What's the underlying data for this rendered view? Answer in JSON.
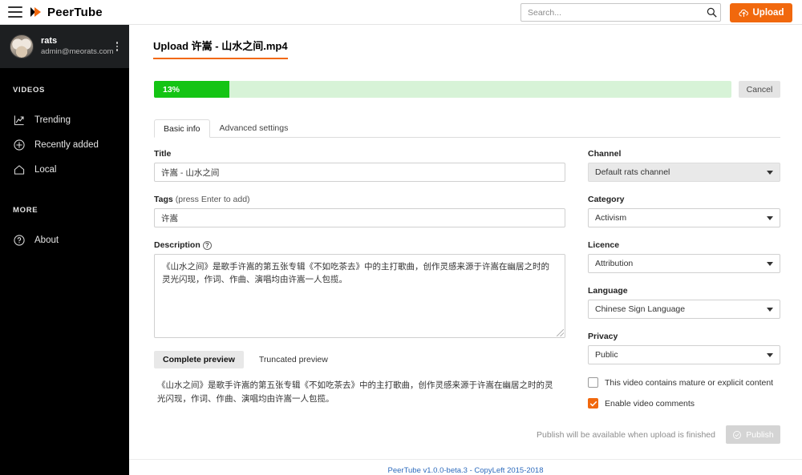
{
  "topbar": {
    "menu_icon": "hamburger-icon",
    "logo_text": "PeerTube",
    "search_placeholder": "Search...",
    "search_value": "",
    "search_icon": "search-icon",
    "upload_label": "Upload",
    "upload_icon": "cloud-upload-icon",
    "accent_color": "#f1680d"
  },
  "sidebar": {
    "user": {
      "name": "rats",
      "email": "admin@meorats.com",
      "avatar": "user-avatar",
      "menu_icon": "more-vertical-icon"
    },
    "sections": [
      {
        "heading": "VIDEOS",
        "items": [
          {
            "label": "Trending",
            "icon": "trending-chart-icon"
          },
          {
            "label": "Recently added",
            "icon": "plus-circle-icon"
          },
          {
            "label": "Local",
            "icon": "home-icon"
          }
        ]
      },
      {
        "heading": "MORE",
        "items": [
          {
            "label": "About",
            "icon": "question-circle-icon"
          }
        ]
      }
    ]
  },
  "main": {
    "page_title": "Upload 许嵩 - 山水之间.mp4",
    "progress": {
      "percent_label": "13%",
      "percent_value": 13,
      "fill_color": "#14c414",
      "track_color": "#d7f3d7",
      "cancel_label": "Cancel"
    },
    "tabs": [
      {
        "label": "Basic info",
        "active": true
      },
      {
        "label": "Advanced settings",
        "active": false
      }
    ],
    "left": {
      "title_label": "Title",
      "title_value": "许嵩 - 山水之间",
      "tags_label": "Tags",
      "tags_hint": "(press Enter to add)",
      "tags_value": "许嵩",
      "description_label": "Description",
      "description_help_icon": "help-circle-icon",
      "description_value": "《山水之间》是歌手许嵩的第五张专辑《不如吃茶去》中的主打歌曲，创作灵感来源于许嵩在幽居之时的灵光闪现，作词、作曲、演唱均由许嵩一人包揽。",
      "preview_tabs": [
        {
          "label": "Complete preview",
          "active": true
        },
        {
          "label": "Truncated preview",
          "active": false
        }
      ],
      "preview_text": "《山水之间》是歌手许嵩的第五张专辑《不如吃茶去》中的主打歌曲，创作灵感来源于许嵩在幽居之时的灵光闪现，作词、作曲、演唱均由许嵩一人包揽。"
    },
    "right": {
      "channel_label": "Channel",
      "channel_value": "Default rats channel",
      "category_label": "Category",
      "category_value": "Activism",
      "licence_label": "Licence",
      "licence_value": "Attribution",
      "language_label": "Language",
      "language_value": "Chinese Sign Language",
      "privacy_label": "Privacy",
      "privacy_value": "Public",
      "mature_label": "This video contains mature or explicit content",
      "mature_checked": false,
      "comments_label": "Enable video comments",
      "comments_checked": true
    },
    "publish_note": "Publish will be available when upload is finished",
    "publish_label": "Publish",
    "publish_icon": "check-circle-icon"
  },
  "footer": {
    "text": "PeerTube v1.0.0-beta.3 - CopyLeft 2015-2018"
  }
}
